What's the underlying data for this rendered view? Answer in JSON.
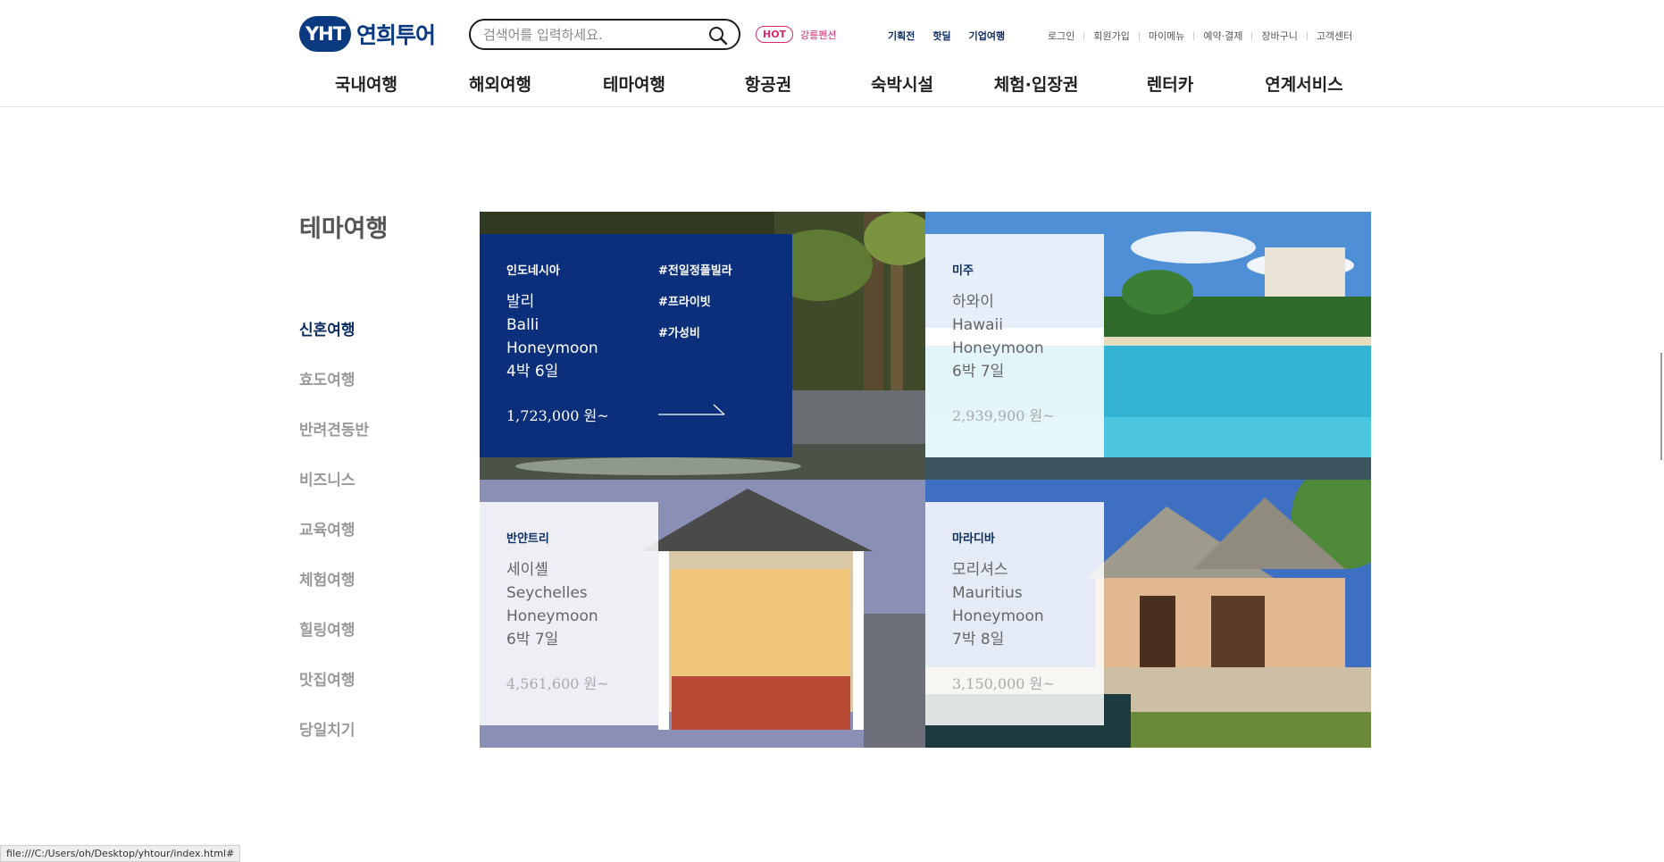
{
  "header": {
    "logo_badge": "YHT",
    "logo_text": "연희투어",
    "search_placeholder": "검색어를 입력하세요.",
    "hot_badge": "HOT",
    "hot_text": "강릉펜션",
    "quick_links": [
      "기획전",
      "핫딜",
      "기업여행"
    ],
    "util_links": [
      "로그인",
      "회원가입",
      "마이메뉴",
      "예약·결제",
      "장바구니",
      "고객센터"
    ],
    "gnb": [
      "국내여행",
      "해외여행",
      "테마여행",
      "항공권",
      "숙박시설",
      "체험·입장권",
      "렌터카",
      "연계서비스"
    ]
  },
  "section": {
    "title": "테마여행",
    "side_menu": [
      "신혼여행",
      "효도여행",
      "반려견동반",
      "비즈니스",
      "교육여행",
      "체험여행",
      "힐링여행",
      "맛집여행",
      "당일치기"
    ],
    "active_item": "신혼여행"
  },
  "cards": [
    {
      "region": "인도네시아",
      "name_ko": "발리",
      "name_en": "Balli",
      "type": "Honeymoon",
      "duration": "4박 6일",
      "price": "1,723,000 원~",
      "tags": [
        "#전일정풀빌라",
        "#프라이빗",
        "#가성비"
      ]
    },
    {
      "region": "미주",
      "name_ko": "하와이",
      "name_en": "Hawaii",
      "type": "Honeymoon",
      "duration": "6박 7일",
      "price": "2,939,900 원~"
    },
    {
      "region": "반얀트리",
      "name_ko": "세이셸",
      "name_en": "Seychelles",
      "type": "Honeymoon",
      "duration": "6박 7일",
      "price": "4,561,600 원~"
    },
    {
      "region": "마라디바",
      "name_ko": "모리셔스",
      "name_en": "Mauritius",
      "type": "Honeymoon",
      "duration": "7박 8일",
      "price": "3,150,000 원~"
    }
  ],
  "status_bar": "file:///C:/Users/oh/Desktop/yhtour/index.html#",
  "colors": {
    "brand": "#0b3a80",
    "card_dark": "#0b2f7a",
    "hot": "#d6286f"
  }
}
